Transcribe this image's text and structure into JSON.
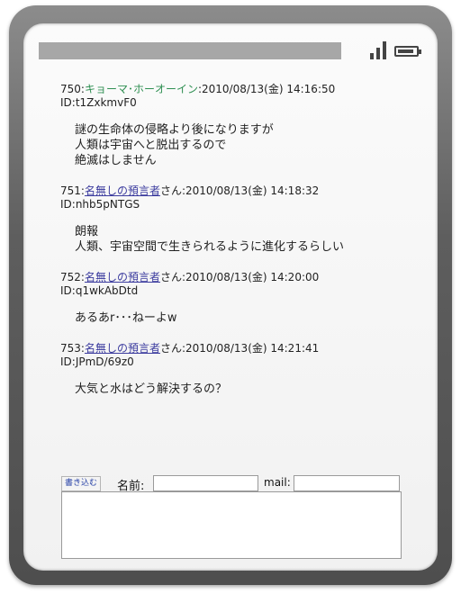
{
  "posts": [
    {
      "number": "750",
      "name": "キョーマ･ホーオーイン",
      "name_suffix": "",
      "datetime": "2010/08/13(金) 14:16:50",
      "id": "ID:t1ZxkmvF0",
      "lines": [
        "謎の生命体の侵略より後になりますが",
        "人類は宇宙へと脱出するので",
        "絶滅はしません"
      ]
    },
    {
      "number": "751",
      "name": "名無しの預言者",
      "name_suffix": "さん",
      "datetime": "2010/08/13(金) 14:18:32",
      "id": "ID:nhb5pNTGS",
      "lines": [
        "朗報",
        "人類、宇宙空間で生きられるように進化するらしい"
      ]
    },
    {
      "number": "752",
      "name": "名無しの預言者",
      "name_suffix": "さん",
      "datetime": "2010/08/13(金) 14:20:00",
      "id": "ID:q1wkAbDtd",
      "lines": [
        "あるあr･･･ねーよw"
      ]
    },
    {
      "number": "753",
      "name": "名無しの預言者",
      "name_suffix": "さん",
      "datetime": "2010/08/13(金) 14:21:41",
      "id": "ID:JPmD/69z0",
      "lines": [
        "大気と水はどう解決するの？"
      ]
    }
  ],
  "form": {
    "submit_label": "書き込む",
    "name_label": "名前",
    "name_value": "",
    "mail_label": "mail",
    "mail_value": "",
    "message_value": ""
  },
  "colors": {
    "name_green": "#2f8f52",
    "name_link": "#3b3b9e",
    "device_frame": "#5e5e5e"
  }
}
